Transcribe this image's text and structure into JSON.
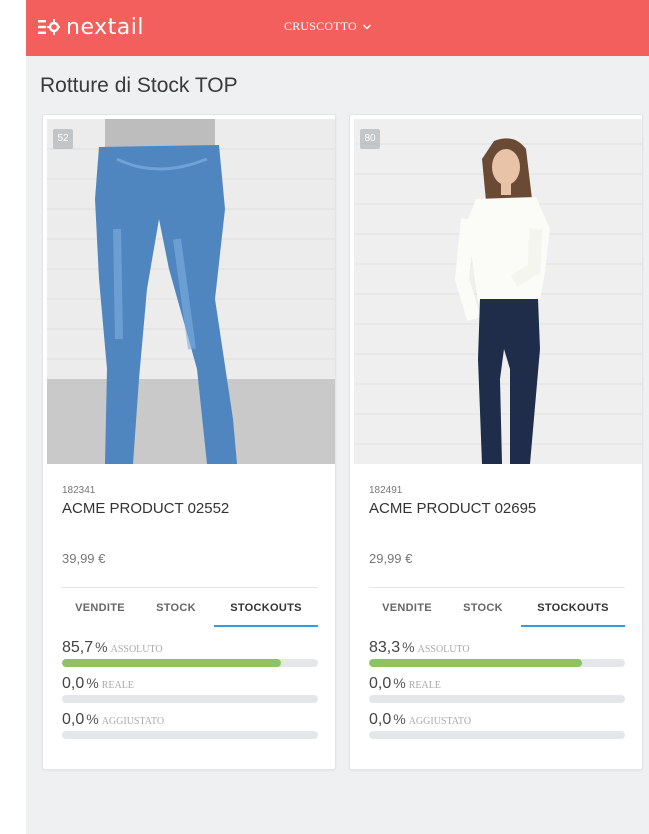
{
  "header": {
    "logo_text": "nextail",
    "menu_label": "CRUSCOTTO",
    "bg_color": "#f25f5c"
  },
  "page": {
    "title": "Rotture di Stock TOP"
  },
  "products": [
    {
      "rank": "52",
      "sku": "182341",
      "name": "ACME PRODUCT 02552",
      "price": "39,99 €",
      "tabs": [
        "VENDITE",
        "STOCK",
        "STOCKOUTS"
      ],
      "active_tab": "STOCKOUTS",
      "metrics": [
        {
          "value": "85,7",
          "unit": "%",
          "label": "ASSOLUTO",
          "fraction": 0.857
        },
        {
          "value": "0,0",
          "unit": "%",
          "label": "REALE",
          "fraction": 0
        },
        {
          "value": "0,0",
          "unit": "%",
          "label": "AGGIUSTATO",
          "fraction": 0
        }
      ]
    },
    {
      "rank": "80",
      "sku": "182491",
      "name": "ACME PRODUCT 02695",
      "price": "29,99 €",
      "tabs": [
        "VENDITE",
        "STOCK",
        "STOCKOUTS"
      ],
      "active_tab": "STOCKOUTS",
      "metrics": [
        {
          "value": "83,3",
          "unit": "%",
          "label": "ASSOLUTO",
          "fraction": 0.833
        },
        {
          "value": "0,0",
          "unit": "%",
          "label": "REALE",
          "fraction": 0
        },
        {
          "value": "0,0",
          "unit": "%",
          "label": "AGGIUSTATO",
          "fraction": 0
        }
      ]
    }
  ]
}
